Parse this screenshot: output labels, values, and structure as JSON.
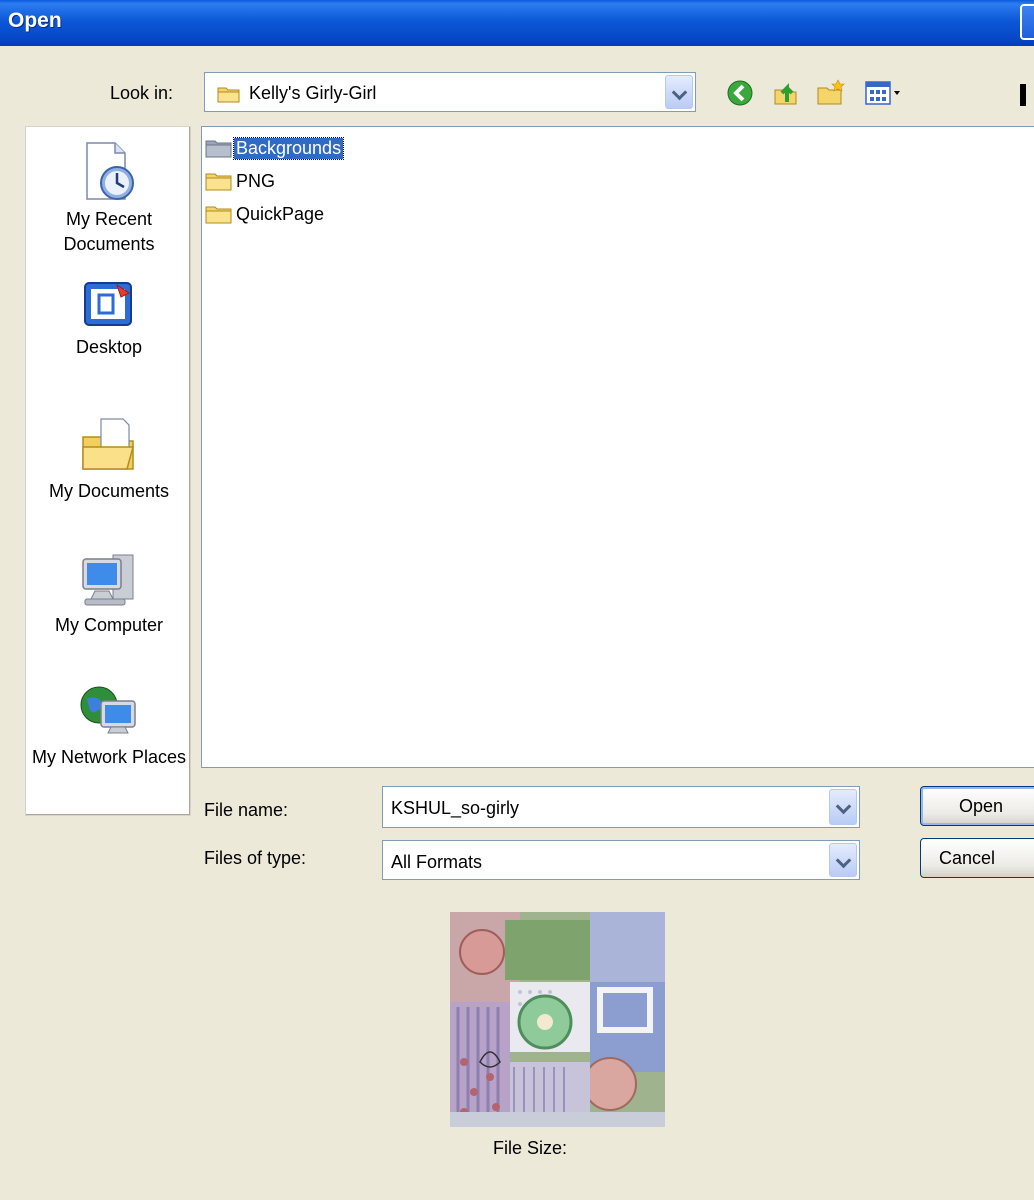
{
  "window": {
    "title": "Open"
  },
  "look_in": {
    "label": "Look in:",
    "value": "Kelly's Girly-Girl"
  },
  "toolbar": {
    "icons": [
      "back-icon",
      "up-folder-icon",
      "new-folder-icon",
      "views-menu-icon"
    ]
  },
  "places": [
    {
      "label": "My Recent Documents",
      "icon": "recent-documents-icon"
    },
    {
      "label": "Desktop",
      "icon": "desktop-icon"
    },
    {
      "label": "My Documents",
      "icon": "my-documents-icon"
    },
    {
      "label": "My Computer",
      "icon": "my-computer-icon"
    },
    {
      "label": "My Network Places",
      "icon": "network-places-icon"
    }
  ],
  "files": [
    {
      "name": "Backgrounds",
      "selected": true
    },
    {
      "name": "PNG",
      "selected": false
    },
    {
      "name": "QuickPage",
      "selected": false
    }
  ],
  "file_name": {
    "label": "File name:",
    "value": "KSHUL_so-girly"
  },
  "file_type": {
    "label": "Files of type:",
    "value": "All Formats"
  },
  "buttons": {
    "open": "Open",
    "cancel": "Cancel"
  },
  "preview": {
    "file_size_label": "File Size:"
  },
  "colors": {
    "selection": "#316AC5",
    "titlebar": "#0B58D8",
    "dialog_bg": "#ECE9D8"
  }
}
